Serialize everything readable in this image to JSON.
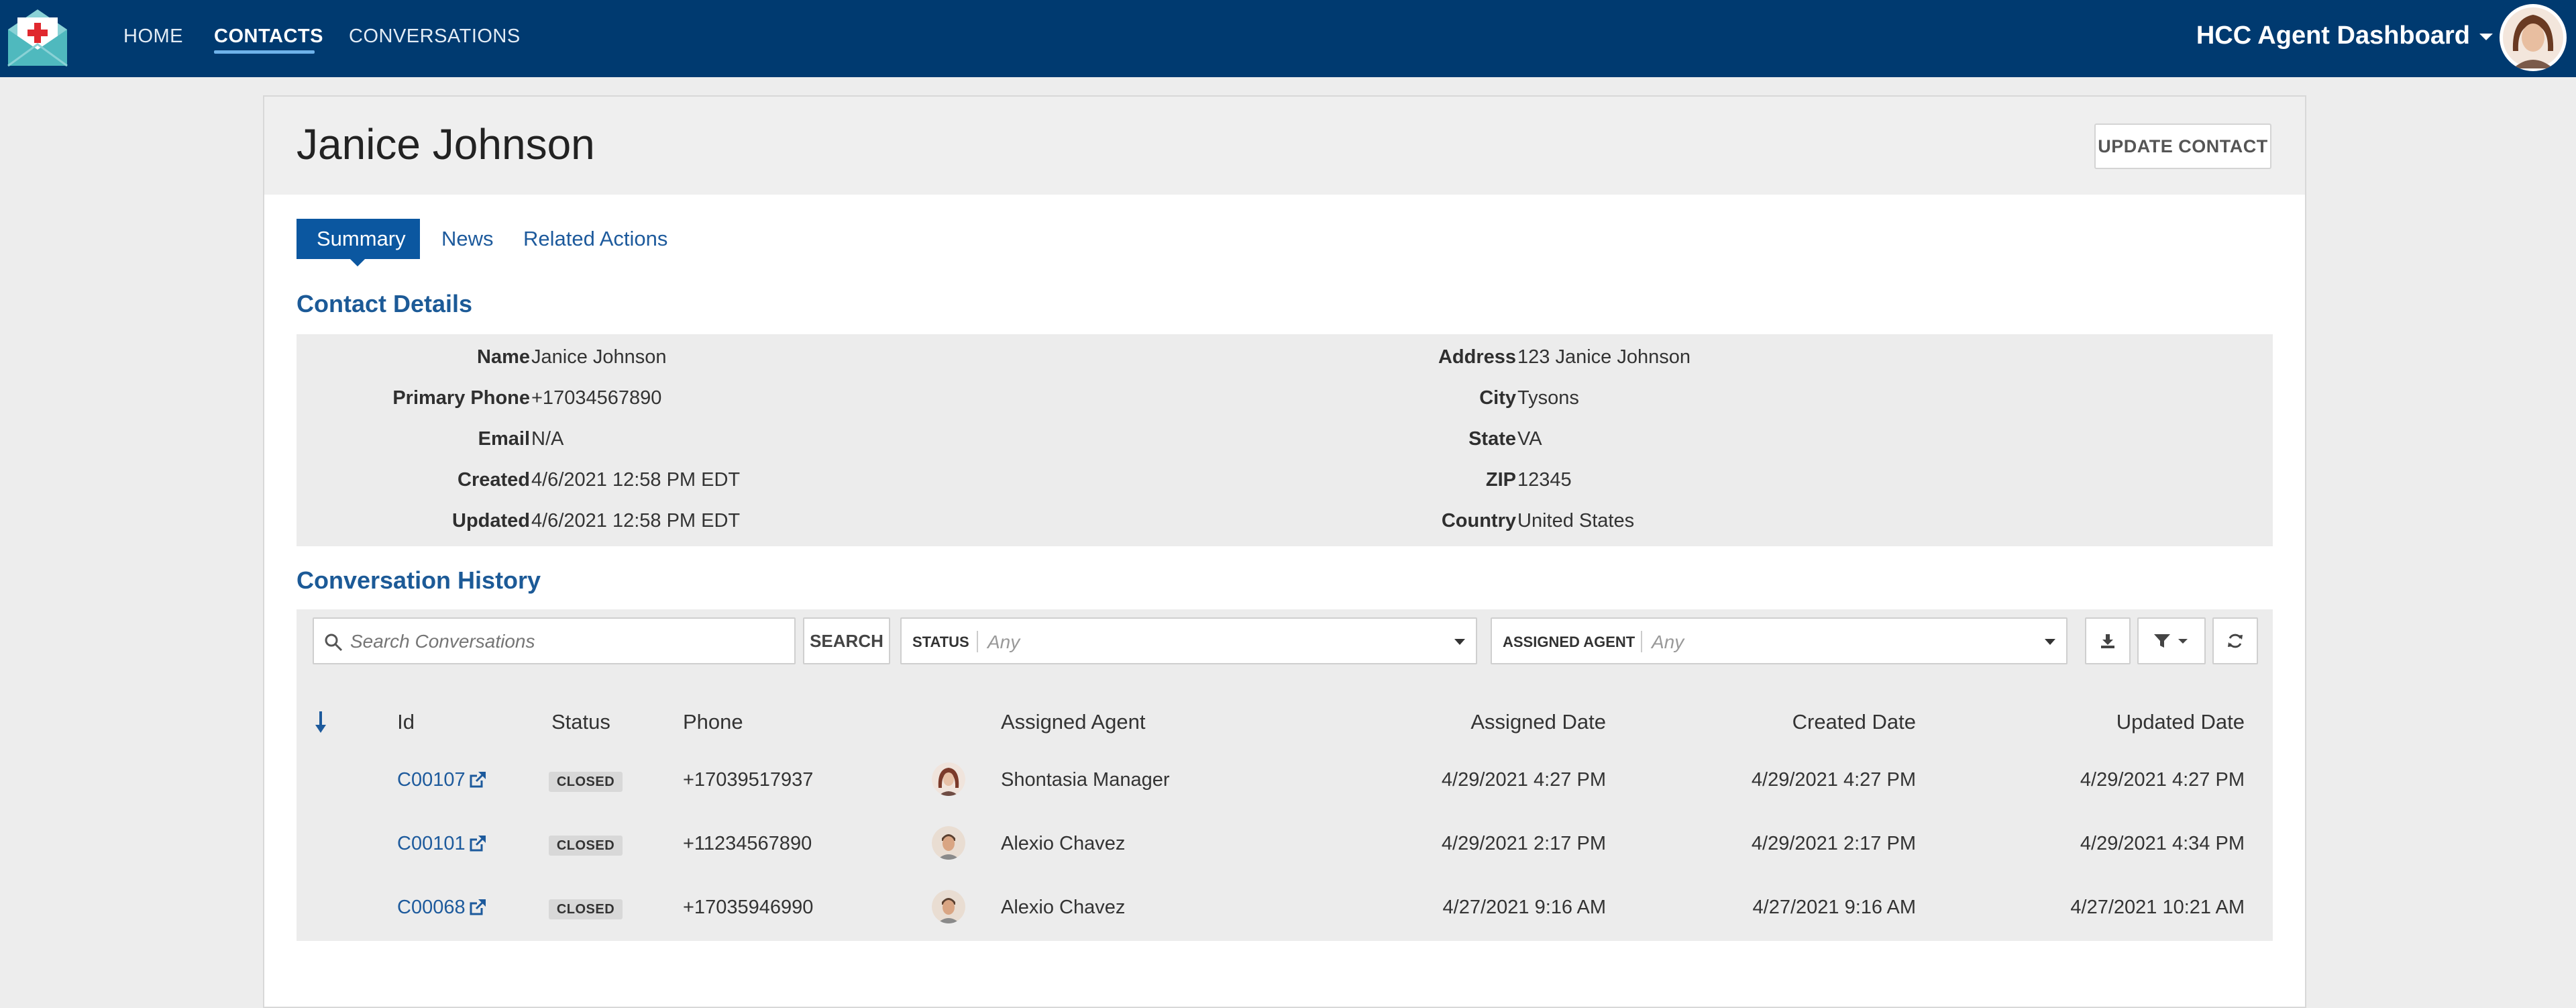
{
  "nav": {
    "items": [
      {
        "label": "HOME"
      },
      {
        "label": "CONTACTS"
      },
      {
        "label": "CONVERSATIONS"
      }
    ],
    "active": "CONTACTS",
    "dashboard_title": "HCC Agent Dashboard"
  },
  "contact": {
    "name": "Janice Johnson",
    "update_button": "UPDATE CONTACT"
  },
  "tabs": [
    {
      "label": "Summary"
    },
    {
      "label": "News"
    },
    {
      "label": "Related Actions"
    }
  ],
  "details": {
    "title": "Contact Details",
    "left": [
      {
        "label": "Name",
        "value": "Janice Johnson"
      },
      {
        "label": "Primary Phone",
        "value": "+17034567890"
      },
      {
        "label": "Email",
        "value": "N/A"
      },
      {
        "label": "Created",
        "value": "4/6/2021 12:58 PM EDT"
      },
      {
        "label": "Updated",
        "value": "4/6/2021 12:58 PM EDT"
      }
    ],
    "right": [
      {
        "label": "Address",
        "value": "123 Janice Johnson"
      },
      {
        "label": "City",
        "value": "Tysons"
      },
      {
        "label": "State",
        "value": "VA"
      },
      {
        "label": "ZIP",
        "value": "12345"
      },
      {
        "label": "Country",
        "value": "United States"
      }
    ]
  },
  "history": {
    "title": "Conversation History",
    "search_placeholder": "Search Conversations",
    "search_button": "SEARCH",
    "status_filter": {
      "label": "STATUS",
      "value": "Any"
    },
    "agent_filter": {
      "label": "ASSIGNED AGENT",
      "value": "Any"
    },
    "columns": [
      "Id",
      "Status",
      "Phone",
      "Assigned Agent",
      "Assigned Date",
      "Created Date",
      "Updated Date"
    ],
    "rows": [
      {
        "id": "C00107",
        "status": "CLOSED",
        "phone": "+17039517937",
        "agent": "Shontasia Manager",
        "agent_avatar": "female",
        "assigned": "4/29/2021 4:27 PM",
        "created": "4/29/2021 4:27 PM",
        "updated": "4/29/2021 4:27 PM"
      },
      {
        "id": "C00101",
        "status": "CLOSED",
        "phone": "+11234567890",
        "agent": "Alexio Chavez",
        "agent_avatar": "male",
        "assigned": "4/29/2021 2:17 PM",
        "created": "4/29/2021 2:17 PM",
        "updated": "4/29/2021 4:34 PM"
      },
      {
        "id": "C00068",
        "status": "CLOSED",
        "phone": "+17035946990",
        "agent": "Alexio Chavez",
        "agent_avatar": "male",
        "assigned": "4/27/2021 9:16 AM",
        "created": "4/27/2021 9:16 AM",
        "updated": "4/27/2021 10:21 AM"
      }
    ]
  },
  "colors": {
    "topbar": "#003a70",
    "accent": "#0b57a0",
    "link": "#1d5a9c"
  }
}
